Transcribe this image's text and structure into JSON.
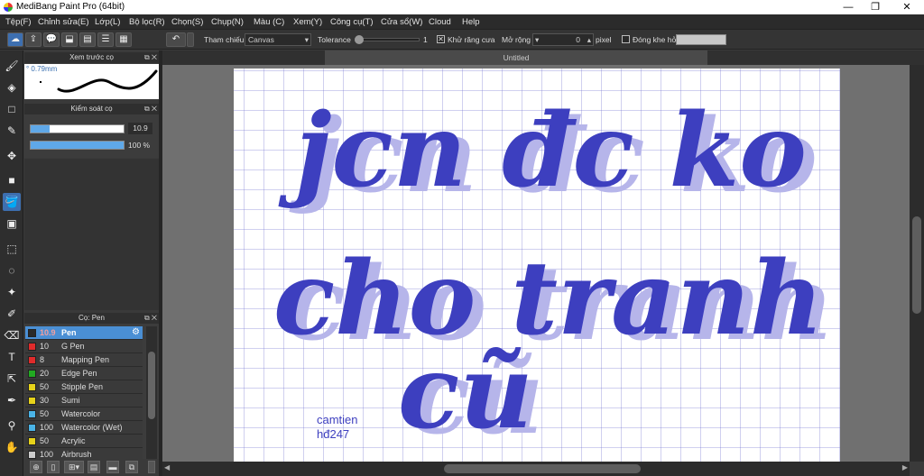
{
  "window": {
    "title": "MediBang Paint Pro (64bit)"
  },
  "menu": [
    "Tệp(F)",
    "Chỉnh sửa(E)",
    "Lớp(L)",
    "Bộ lọc(R)",
    "Chọn(S)",
    "Chụp(N)",
    "Màu (C)",
    "Xem(Y)",
    "Công cụ(T)",
    "Cửa sổ(W)",
    "Cloud",
    "Help"
  ],
  "toolbar": {
    "reference_label": "Tham chiếu",
    "reference_value": "Canvas",
    "tolerance_label": "Tolerance",
    "tolerance_value": "1",
    "antialias_label": "Khử răng cưa",
    "antialias_checked": true,
    "expand_label": "Mở rộng",
    "expand_value": "0",
    "expand_unit": "pixel",
    "close_gap_label": "Đóng khe hở",
    "close_gap_checked": false
  },
  "brush_preview": {
    "title": "Xem trước cọ",
    "size": "0.79mm"
  },
  "brush_control": {
    "title": "Kiểm soát cọ",
    "size_value": "10.9",
    "opacity_value": "100 %",
    "size_fraction": 0.2,
    "opacity_fraction": 1.0
  },
  "brush_list": {
    "title": "Cọ: Pen",
    "items": [
      {
        "size": "10.9",
        "name": "Pen",
        "color": "#2a2a2a",
        "selected": true
      },
      {
        "size": "10",
        "name": "G Pen",
        "color": "#e02b2b"
      },
      {
        "size": "8",
        "name": "Mapping Pen",
        "color": "#e02b2b"
      },
      {
        "size": "20",
        "name": "Edge Pen",
        "color": "#22aa22"
      },
      {
        "size": "50",
        "name": "Stipple Pen",
        "color": "#e6d21a"
      },
      {
        "size": "30",
        "name": "Sumi",
        "color": "#e6d21a"
      },
      {
        "size": "50",
        "name": "Watercolor",
        "color": "#4ab3e6"
      },
      {
        "size": "100",
        "name": "Watercolor (Wet)",
        "color": "#4ab3e6"
      },
      {
        "size": "50",
        "name": "Acrylic",
        "color": "#e6d21a"
      },
      {
        "size": "100",
        "name": "Airbrush",
        "color": "#cccccc"
      }
    ]
  },
  "document": {
    "tab": "Untitled"
  },
  "artwork": {
    "line1": "jcn đc ko",
    "line2": "cho tranh",
    "line3": "cũ",
    "signature1": "camtien",
    "signature2": "hđ247",
    "ink_color": "#3d3fbf",
    "shadow_color": "#b6b5ea"
  }
}
